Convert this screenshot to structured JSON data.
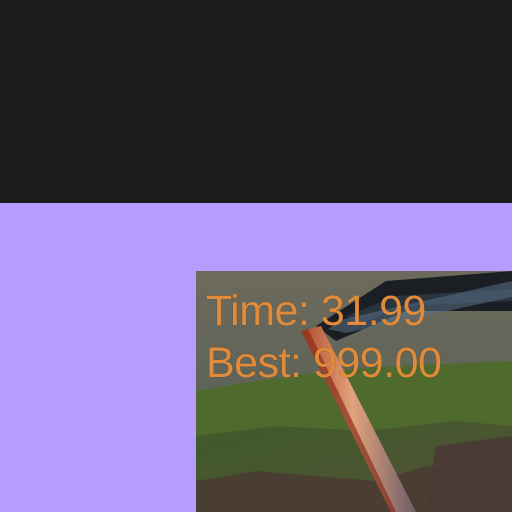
{
  "hud": {
    "time_label": "Time:",
    "time_value": "31.99",
    "best_label": "Best:",
    "best_value": "999.00"
  },
  "colors": {
    "top_band": "#1d1d1b",
    "background": "#b79cff",
    "hud_text": "#e08a3a"
  }
}
